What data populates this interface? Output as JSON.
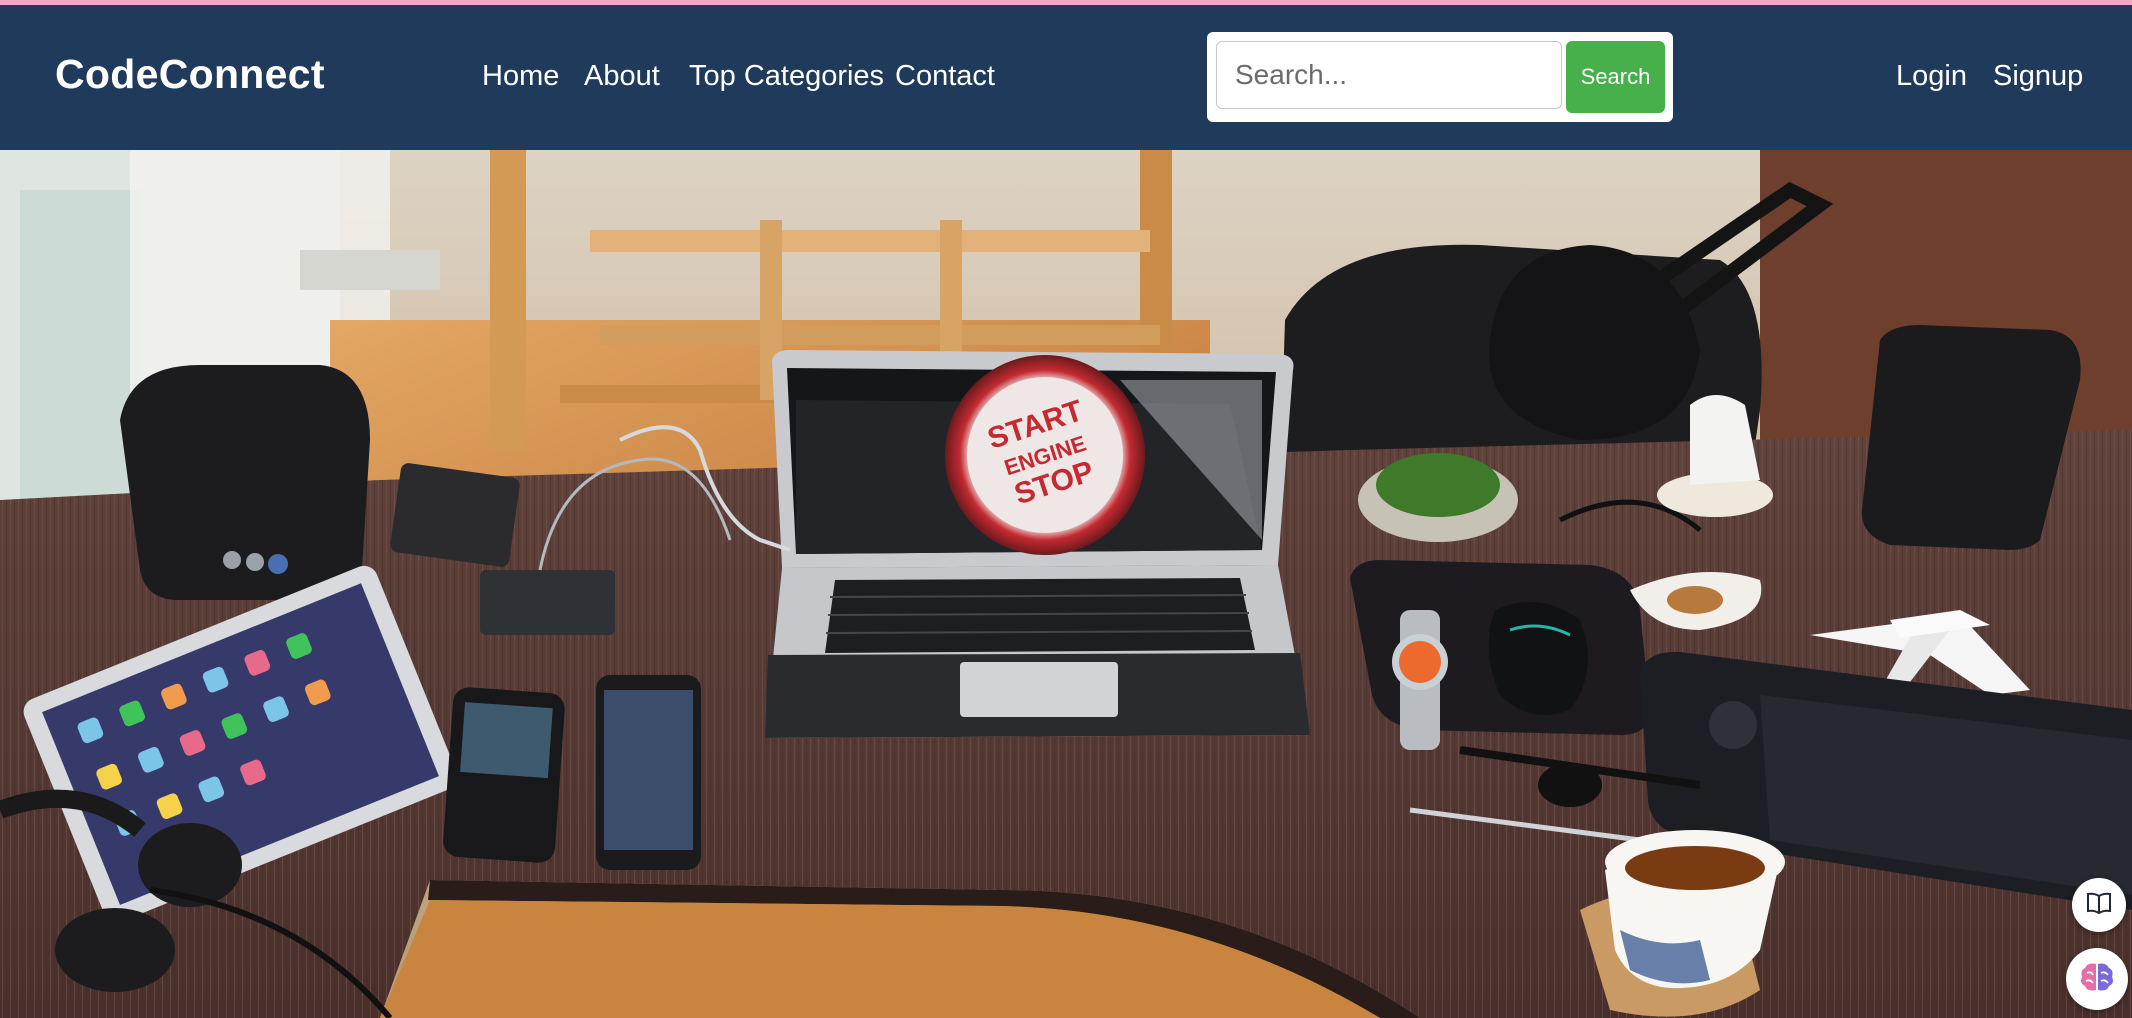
{
  "brand": {
    "name": "CodeConnect"
  },
  "nav": {
    "home": "Home",
    "about": "About",
    "top_categories": "Top Categories",
    "contact": "Contact"
  },
  "search": {
    "placeholder": "Search...",
    "button_label": "Search"
  },
  "auth": {
    "login": "Login",
    "signup": "Signup"
  },
  "hero": {
    "laptop_screen_text": [
      "START",
      "ENGINE",
      "STOP"
    ]
  },
  "icons": {
    "reader": "book-open-icon",
    "assistant": "brain-icon"
  },
  "colors": {
    "navbar": "#1f3a5a",
    "search_button": "#47b04b",
    "accent_top": "#f4a9c9"
  }
}
